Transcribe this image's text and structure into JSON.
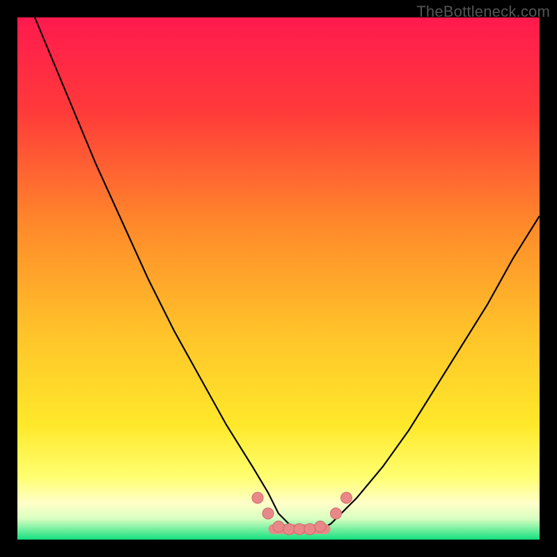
{
  "watermark": "TheBottleneck.com",
  "colors": {
    "frame": "#000000",
    "gradient_top": "#ff1a4e",
    "gradient_mid1": "#ff7a2a",
    "gradient_mid2": "#ffd82a",
    "gradient_low": "#ffff66",
    "gradient_low2": "#ffffb0",
    "gradient_bottom": "#14e07f",
    "curve": "#000000",
    "marker_fill": "#e98888",
    "marker_stroke": "#cc6b6b"
  },
  "chart_data": {
    "type": "line",
    "title": "",
    "xlabel": "",
    "ylabel": "",
    "xlim": [
      0,
      100
    ],
    "ylim": [
      0,
      100
    ],
    "series": [
      {
        "name": "bottleneck-curve",
        "x": [
          0,
          5,
          10,
          15,
          20,
          25,
          30,
          35,
          40,
          45,
          48,
          50,
          52,
          54,
          56,
          58,
          60,
          62,
          65,
          70,
          75,
          80,
          85,
          90,
          95,
          100
        ],
        "y": [
          108,
          96,
          84,
          72,
          61,
          50,
          40,
          31,
          22,
          14,
          9,
          5,
          3,
          2,
          2,
          2,
          3,
          5,
          8,
          14,
          21,
          29,
          37,
          45,
          54,
          62
        ]
      }
    ],
    "markers": [
      {
        "name": "left-cluster-1",
        "x": 46,
        "y": 8
      },
      {
        "name": "left-cluster-2",
        "x": 48,
        "y": 5
      },
      {
        "name": "floor-1",
        "x": 50,
        "y": 2.5
      },
      {
        "name": "floor-2",
        "x": 52,
        "y": 2
      },
      {
        "name": "floor-3",
        "x": 54,
        "y": 2
      },
      {
        "name": "floor-4",
        "x": 56,
        "y": 2
      },
      {
        "name": "floor-5",
        "x": 58,
        "y": 2.5
      },
      {
        "name": "right-cluster-1",
        "x": 61,
        "y": 5
      },
      {
        "name": "right-cluster-2",
        "x": 63,
        "y": 8
      }
    ],
    "floor_segment": {
      "x1": 49,
      "x2": 59,
      "y": 2
    },
    "annotations": []
  }
}
